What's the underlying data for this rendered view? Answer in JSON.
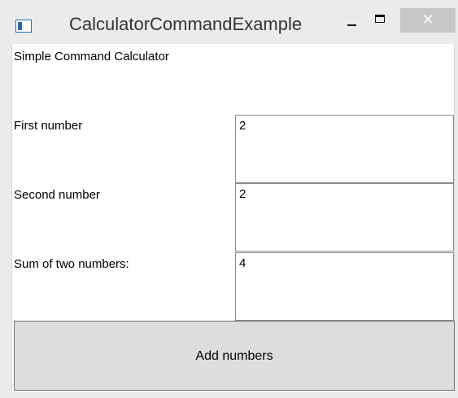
{
  "window": {
    "title": "CalculatorCommandExample",
    "controls": {
      "minimize": "minimize",
      "maximize": "maximize",
      "close_glyph": "✕"
    },
    "icon": "app-window-icon"
  },
  "content": {
    "heading": "Simple Command Calculator",
    "rows": [
      {
        "label": "First number",
        "value": "2"
      },
      {
        "label": "Second number",
        "value": "2"
      },
      {
        "label": "Sum of two numbers:",
        "value": "4"
      }
    ],
    "button_label": "Add numbers"
  },
  "colors": {
    "titlebar": "#ebebeb",
    "close_button": "#c7c7c7",
    "button_face": "#dddddd",
    "field_border": "#8c8c8c"
  }
}
